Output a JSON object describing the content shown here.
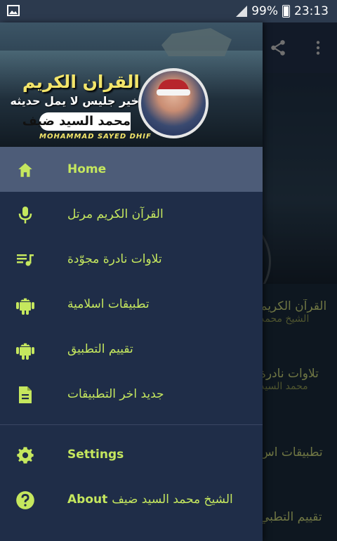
{
  "status": {
    "battery": "99%",
    "time": "23:13"
  },
  "header": {
    "title": "القران الكريم",
    "subtitle": "خير جليس لا يمل حديثه",
    "reciter_ar": "محمد السيد ضيف",
    "reciter_en": "MOHAMMAD SAYED DHIF"
  },
  "menu": {
    "items": [
      {
        "label": "Home",
        "icon": "home-icon"
      },
      {
        "label": "القرآن الكريم مرتل",
        "icon": "mic-icon"
      },
      {
        "label": "تلاوات نادرة مجوّدة",
        "icon": "playlist-icon"
      },
      {
        "label": "تطبيقات اسلامية",
        "icon": "android-icon"
      },
      {
        "label": "تقييم التطبيق",
        "icon": "android-icon"
      },
      {
        "label": "جديد اخر التطبيقات",
        "icon": "document-icon"
      }
    ],
    "secondary": [
      {
        "label": "Settings",
        "icon": "gear-icon"
      },
      {
        "label": "About",
        "extra": "الشيخ محمد السيد ضيف",
        "icon": "help-icon"
      }
    ]
  },
  "background": {
    "items": [
      {
        "title": "القرآن الكريم",
        "sub": "الشيخ محمد"
      },
      {
        "title": "تلاوات نادرة",
        "sub": "محمد السيد"
      },
      {
        "title": "تطبيقات اس",
        "sub": ""
      },
      {
        "title": "تقييم التطبي",
        "sub": ""
      }
    ]
  },
  "colors": {
    "accent": "#c5e75e",
    "drawer": "#1f2d48",
    "active_row": "#4d5c78"
  }
}
